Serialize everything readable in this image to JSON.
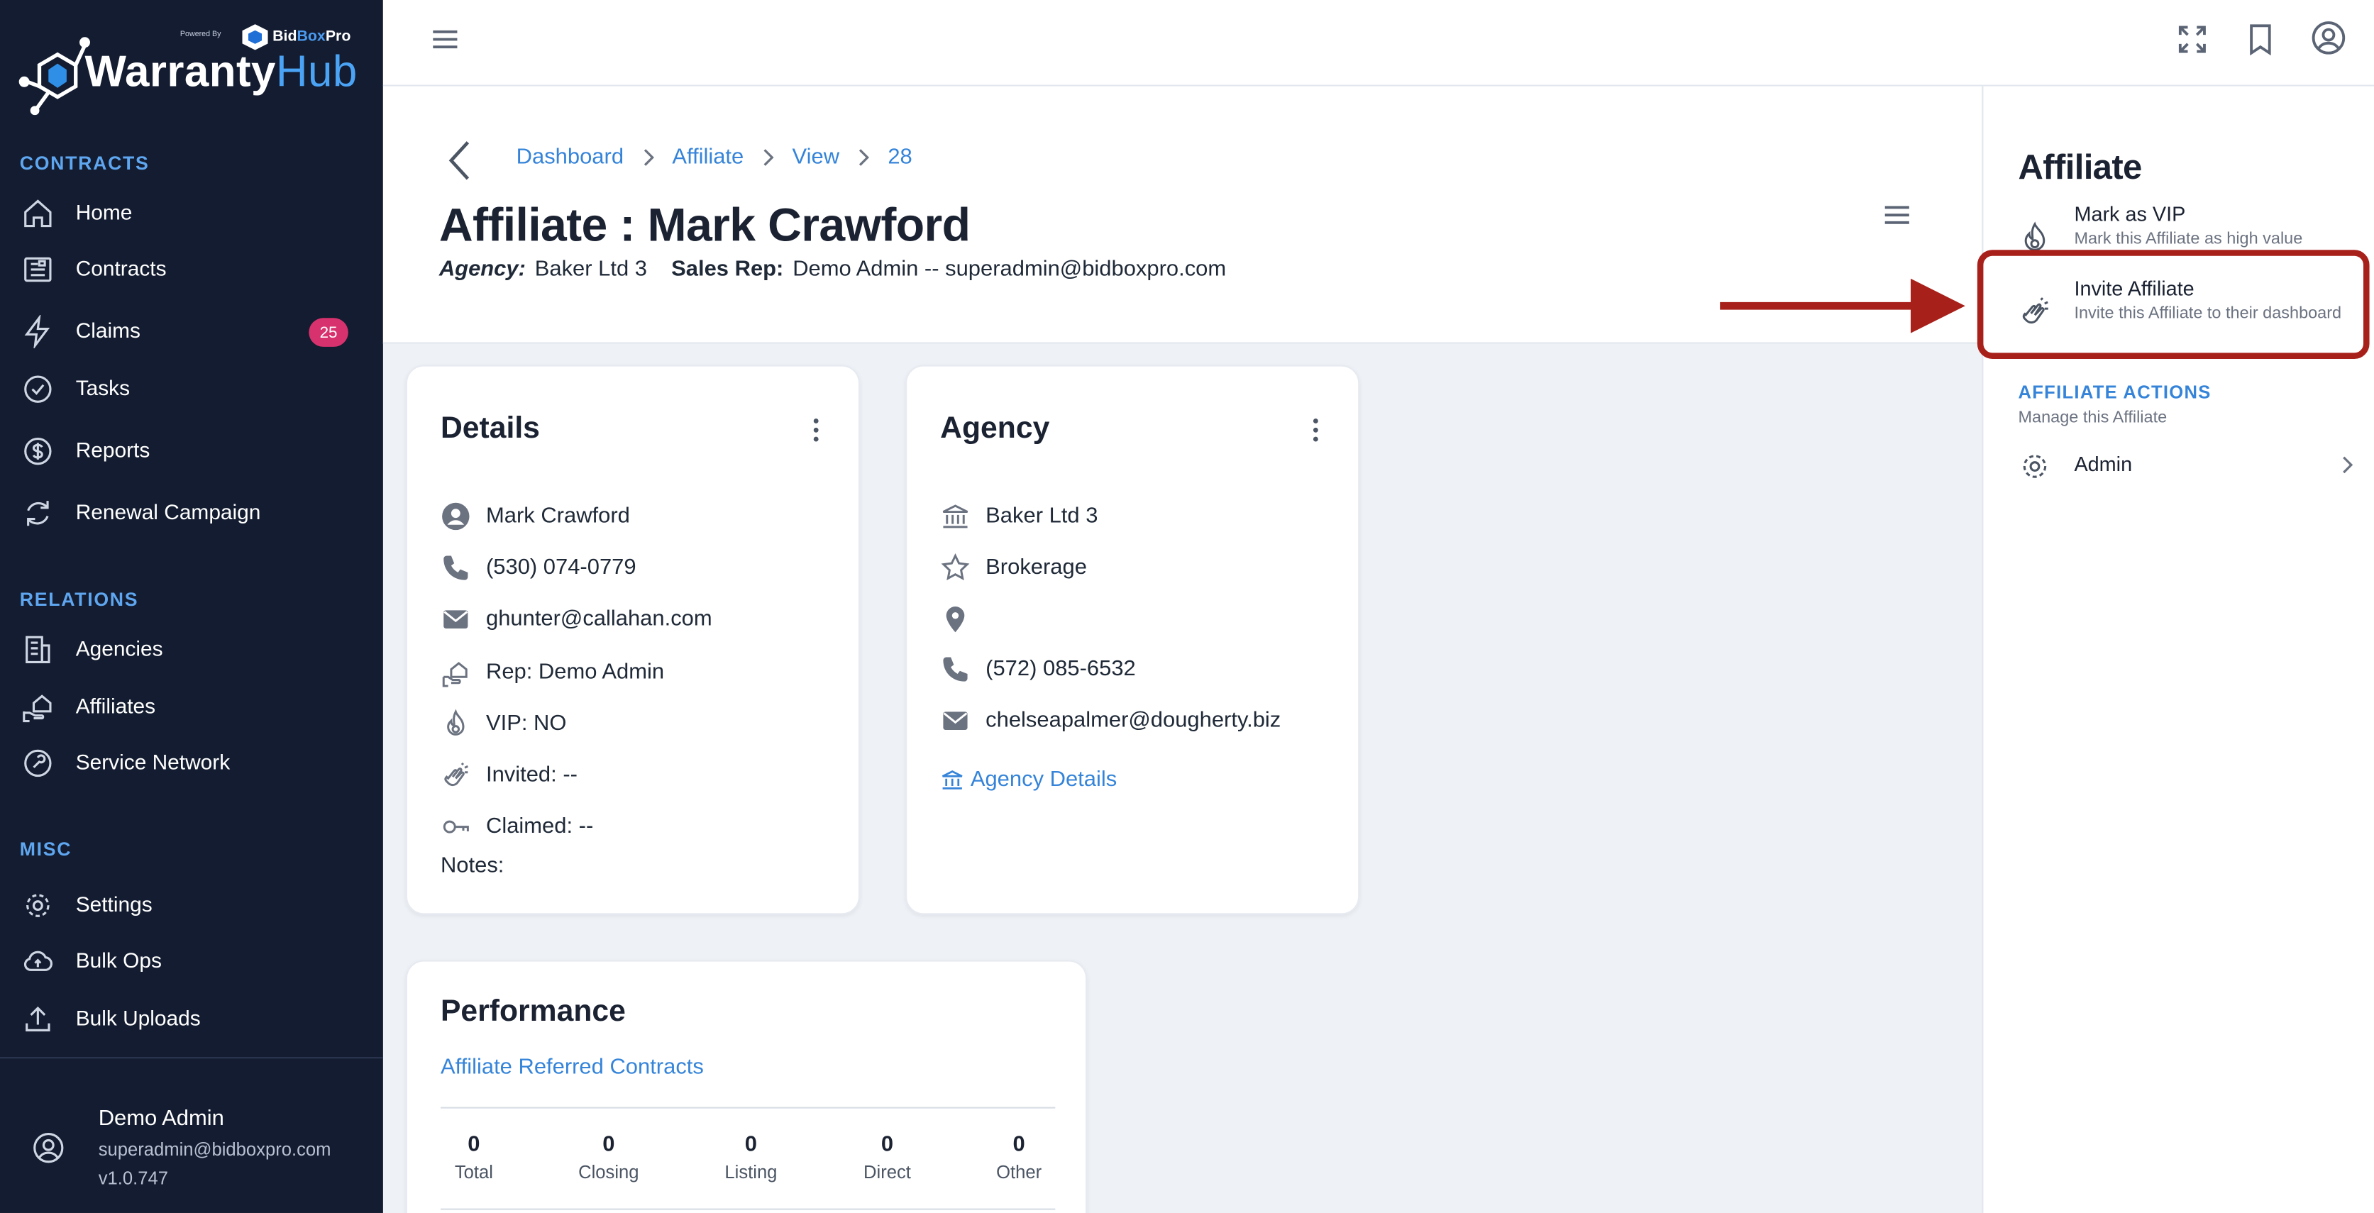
{
  "brand": {
    "powered_by": "Powered By",
    "bidboxpro_name": "Bid",
    "bidboxpro_box": "Box",
    "bidboxpro_pro": "Pro",
    "title_warranty": "Warranty",
    "title_hub": "Hub"
  },
  "sidebar": {
    "sections": {
      "contracts": "CONTRACTS",
      "relations": "RELATIONS",
      "misc": "MISC"
    },
    "items": {
      "home": "Home",
      "contracts": "Contracts",
      "claims": "Claims",
      "claims_badge": "25",
      "tasks": "Tasks",
      "reports": "Reports",
      "renewal": "Renewal Campaign",
      "agencies": "Agencies",
      "affiliates": "Affiliates",
      "service_network": "Service Network",
      "settings": "Settings",
      "bulk_ops": "Bulk Ops",
      "bulk_uploads": "Bulk Uploads"
    },
    "user": {
      "name": "Demo Admin",
      "email": "superadmin@bidboxpro.com",
      "version": "v1.0.747"
    }
  },
  "breadcrumb": {
    "dashboard": "Dashboard",
    "affiliate": "Affiliate",
    "view": "View",
    "id": "28"
  },
  "header": {
    "title": "Affiliate : Mark Crawford",
    "agency_label": "Agency:",
    "agency_value": "Baker Ltd 3",
    "rep_label": "Sales Rep:",
    "rep_value": "Demo Admin -- superadmin@bidboxpro.com"
  },
  "details": {
    "title": "Details",
    "name": "Mark Crawford",
    "phone": "(530) 074-0779",
    "email": "ghunter@callahan.com",
    "rep": "Rep: Demo Admin",
    "vip": "VIP: NO",
    "invited": "Invited: --",
    "claimed": "Claimed: --",
    "notes": "Notes:"
  },
  "agency": {
    "title": "Agency",
    "name": "Baker Ltd 3",
    "type": "Brokerage",
    "location": "",
    "phone": "(572) 085-6532",
    "email": "chelseapalmer@dougherty.biz",
    "details_link": "Agency Details"
  },
  "performance": {
    "title": "Performance",
    "link": "Affiliate Referred Contracts",
    "stats": [
      {
        "value": "0",
        "label": "Total"
      },
      {
        "value": "0",
        "label": "Closing"
      },
      {
        "value": "0",
        "label": "Listing"
      },
      {
        "value": "0",
        "label": "Direct"
      },
      {
        "value": "0",
        "label": "Other"
      }
    ]
  },
  "right_panel": {
    "title": "Affiliate",
    "vip_label": "Mark as VIP",
    "vip_sub": "Mark this Affiliate as high value",
    "invite_label": "Invite Affiliate",
    "invite_sub": "Invite this Affiliate to their dashboard",
    "actions_title": "AFFILIATE ACTIONS",
    "actions_sub": "Manage this Affiliate",
    "admin_label": "Admin"
  },
  "colors": {
    "sidebar_bg": "#131c30",
    "accent": "#3584d9",
    "badge": "#d8326e",
    "highlight": "#a8201a"
  }
}
